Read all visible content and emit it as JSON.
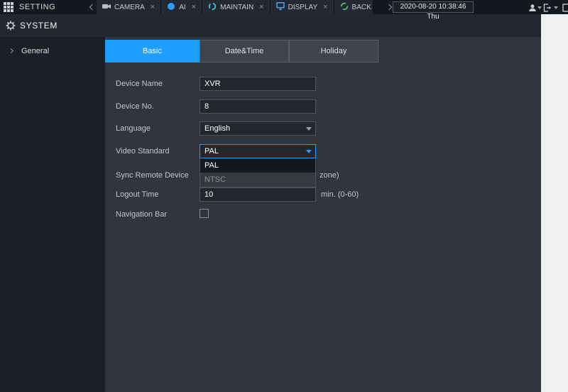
{
  "topbar": {
    "app_label": "SETTING",
    "datetime": "2020-08-20 10:38:46 Thu",
    "tabs": [
      {
        "label": "CAMERA"
      },
      {
        "label": "AI"
      },
      {
        "label": "MAINTAIN"
      },
      {
        "label": "DISPLAY"
      },
      {
        "label": "BACK"
      }
    ]
  },
  "icons": {
    "close": "×"
  },
  "header": {
    "title": "SYSTEM"
  },
  "sidebar": {
    "items": [
      {
        "label": "General"
      }
    ]
  },
  "main": {
    "tabs": [
      {
        "label": "Basic",
        "active": true
      },
      {
        "label": "Date&Time",
        "active": false
      },
      {
        "label": "Holiday",
        "active": false
      }
    ],
    "form": {
      "device_name": {
        "label": "Device Name",
        "value": "XVR"
      },
      "device_no": {
        "label": "Device No.",
        "value": "8"
      },
      "language": {
        "label": "Language",
        "value": "English"
      },
      "video_standard": {
        "label": "Video Standard",
        "value": "PAL"
      },
      "dropdown_options": [
        {
          "label": "PAL",
          "selected": true
        },
        {
          "label": "NTSC",
          "selected": false
        }
      ],
      "sync_remote": {
        "label": "Sync Remote Device",
        "visible_note": "zone)"
      },
      "logout_time": {
        "label": "Logout Time",
        "value": "10",
        "unit": "min. (0-60)"
      },
      "navigation_bar": {
        "label": "Navigation Bar",
        "checked": false
      }
    }
  },
  "colors": {
    "accent": "#1e9fff"
  }
}
